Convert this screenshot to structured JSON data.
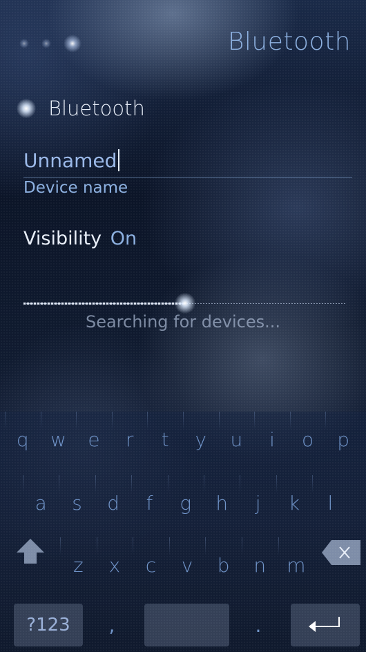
{
  "header": {
    "title": "Bluetooth"
  },
  "bluetooth_switch": {
    "label": "Bluetooth",
    "enabled": true
  },
  "device_name": {
    "value": "Unnamed",
    "label": "Device name"
  },
  "visibility": {
    "label": "Visibility",
    "value": "On"
  },
  "search": {
    "status": "Searching for devices...",
    "progress": 0.5
  },
  "keyboard": {
    "row1": [
      "q",
      "w",
      "e",
      "r",
      "t",
      "y",
      "u",
      "i",
      "o",
      "p"
    ],
    "row2": [
      "a",
      "s",
      "d",
      "f",
      "g",
      "h",
      "j",
      "k",
      "l"
    ],
    "row3": [
      "z",
      "x",
      "c",
      "v",
      "b",
      "n",
      "m"
    ],
    "symbols_label": "?123",
    "comma": ",",
    "period": ".",
    "icons": {
      "shift": "shift-icon",
      "backspace": "backspace-icon",
      "enter": "enter-icon"
    }
  },
  "colors": {
    "accent": "#8cb0e0",
    "primary_text": "#e8eef8",
    "key_text": "#6f93c8"
  }
}
